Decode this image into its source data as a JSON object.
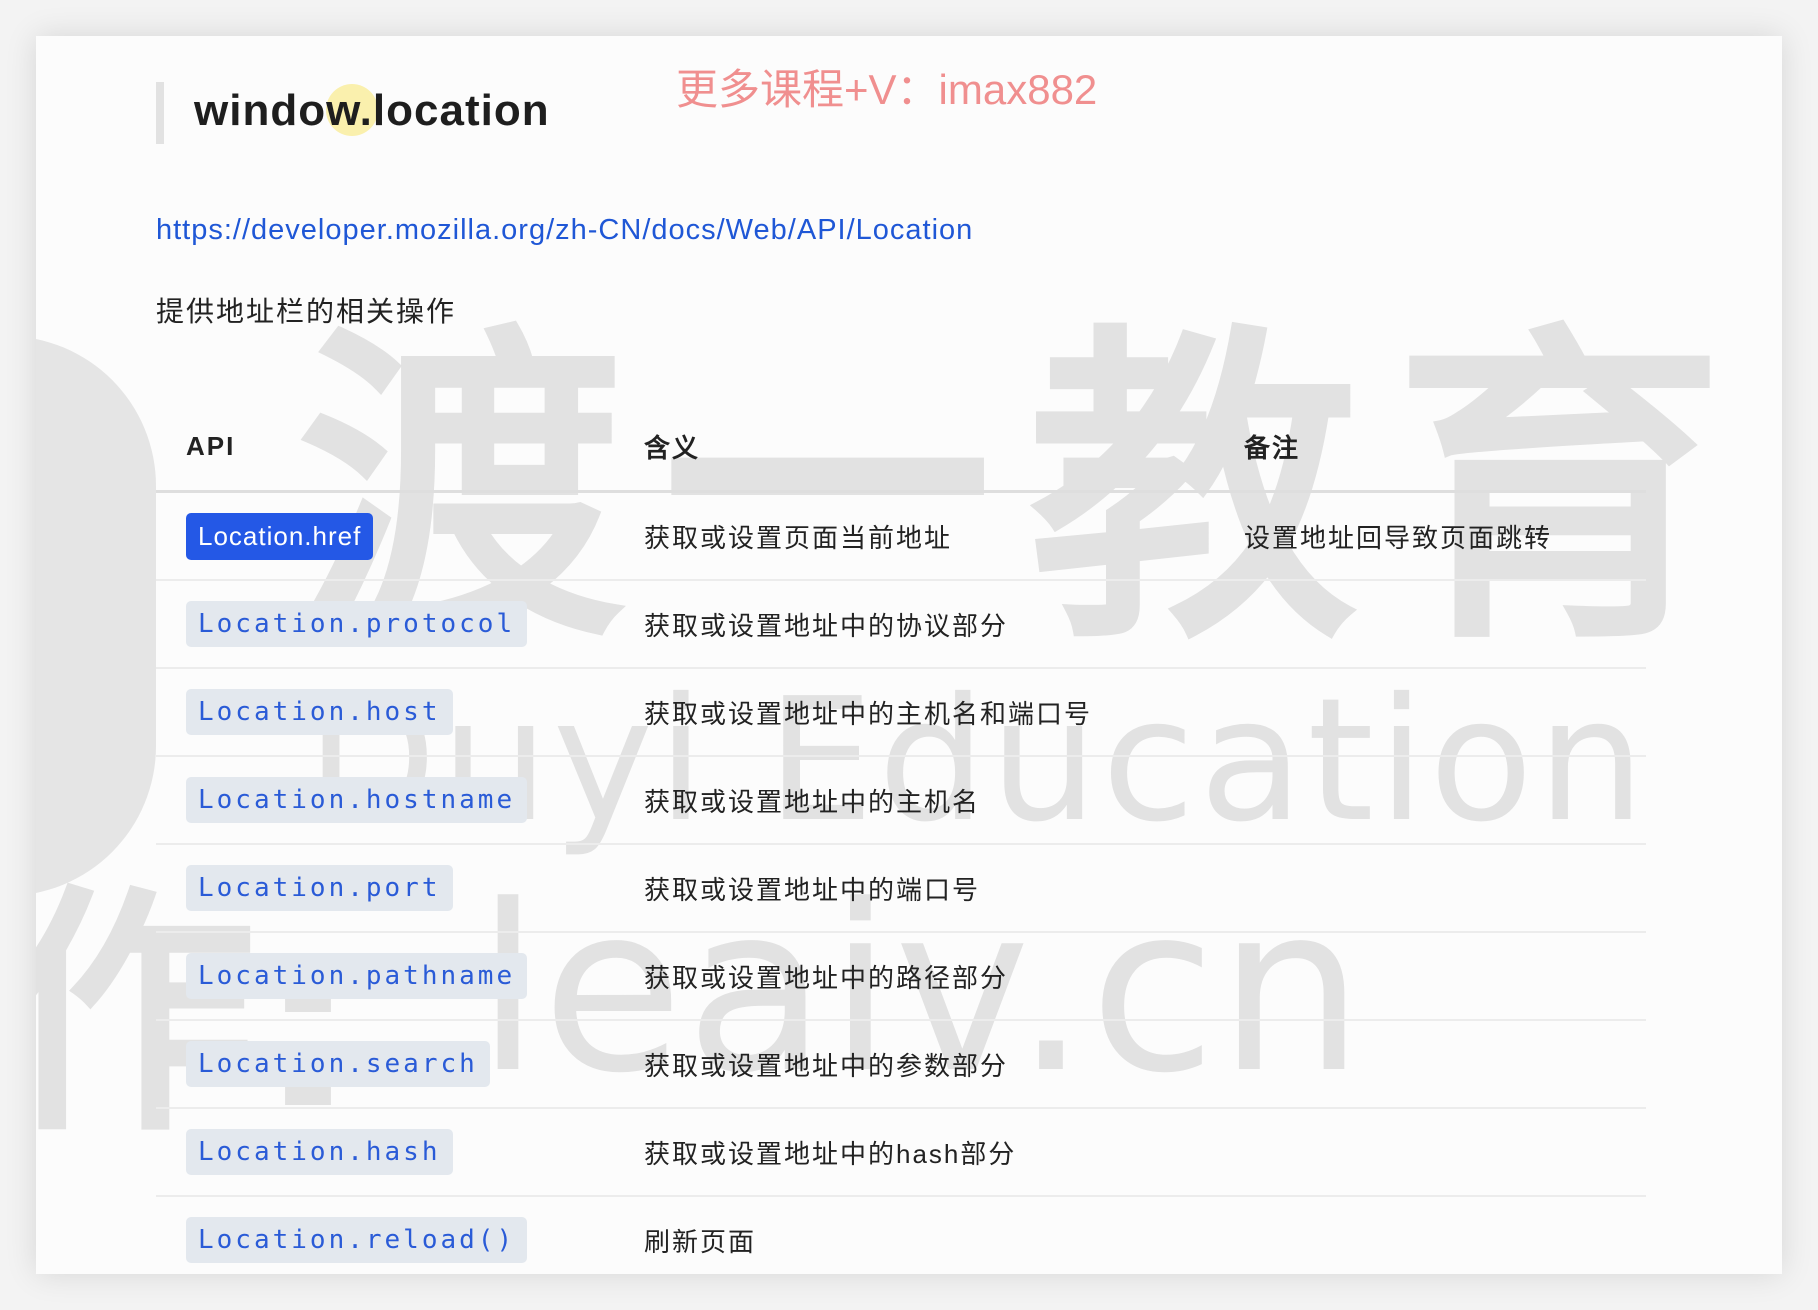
{
  "heading": "window.location",
  "promo": "更多课程+V：imax882",
  "link": "https://developer.mozilla.org/zh-CN/docs/Web/API/Location",
  "description": "提供地址栏的相关操作",
  "table": {
    "headers": [
      "API",
      "含义",
      "备注"
    ],
    "rows": [
      {
        "api": "Location.href",
        "meaning": "获取或设置页面当前地址",
        "note": "设置地址回导致页面跳转",
        "selected": true
      },
      {
        "api": "Location.protocol",
        "meaning": "获取或设置地址中的协议部分",
        "note": ""
      },
      {
        "api": "Location.host",
        "meaning": "获取或设置地址中的主机名和端口号",
        "note": ""
      },
      {
        "api": "Location.hostname",
        "meaning": "获取或设置地址中的主机名",
        "note": ""
      },
      {
        "api": "Location.port",
        "meaning": "获取或设置地址中的端口号",
        "note": ""
      },
      {
        "api": "Location.pathname",
        "meaning": "获取或设置地址中的路径部分",
        "note": ""
      },
      {
        "api": "Location.search",
        "meaning": "获取或设置地址中的参数部分",
        "note": ""
      },
      {
        "api": "Location.hash",
        "meaning": "获取或设置地址中的hash部分",
        "note": ""
      },
      {
        "api": "Location.reload()",
        "meaning": "刷新页面",
        "note": ""
      }
    ]
  },
  "watermark": {
    "cn": "渡一教育",
    "en": "Duyi Education",
    "url": "leaiv.cn",
    "side": "作:"
  },
  "colors": {
    "link": "#1f57d6",
    "code_text": "#2a5bd7",
    "code_bg": "#e3e8ee",
    "selection": "#2458e6",
    "promo": "#f08f8f"
  }
}
